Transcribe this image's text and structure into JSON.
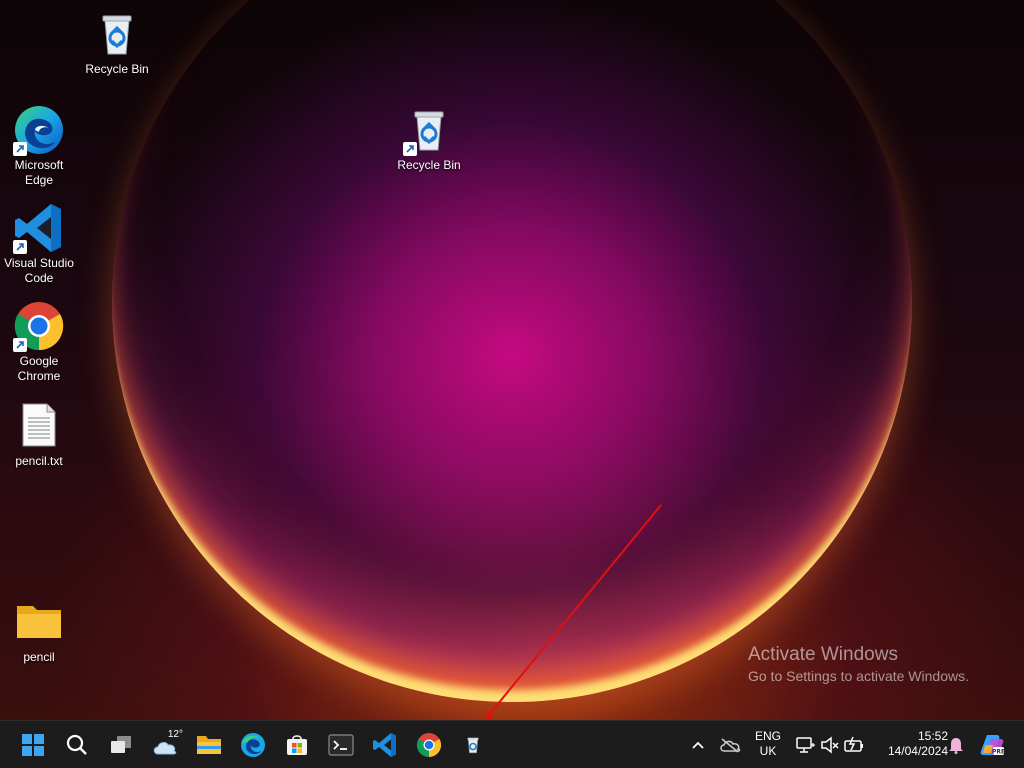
{
  "desktop_icons": [
    {
      "id": "recycle-bin-1",
      "label": "Recycle Bin",
      "icon": "recycle-bin-icon",
      "shortcut": false
    },
    {
      "id": "microsoft-edge",
      "label": "Microsoft Edge",
      "icon": "edge-icon",
      "shortcut": true
    },
    {
      "id": "vscode",
      "label": "Visual Studio Code",
      "icon": "vscode-icon",
      "shortcut": true
    },
    {
      "id": "google-chrome",
      "label": "Google Chrome",
      "icon": "chrome-icon",
      "shortcut": true
    },
    {
      "id": "pencil-txt",
      "label": "pencil.txt",
      "icon": "text-file-icon",
      "shortcut": false
    },
    {
      "id": "pencil-folder",
      "label": "pencil",
      "icon": "folder-icon",
      "shortcut": false
    },
    {
      "id": "recycle-bin-2",
      "label": "Recycle Bin",
      "icon": "recycle-bin-icon",
      "shortcut": true
    }
  ],
  "desktop": {
    "icon_label_0": "Recycle Bin",
    "icon_label_1a": "Microsoft",
    "icon_label_1b": "Edge",
    "icon_label_2a": "Visual Studio",
    "icon_label_2b": "Code",
    "icon_label_3a": "Google",
    "icon_label_3b": "Chrome",
    "icon_label_4": "pencil.txt",
    "icon_label_5": "pencil",
    "icon_label_6": "Recycle Bin"
  },
  "watermark": {
    "title": "Activate Windows",
    "subtitle": "Go to Settings to activate Windows."
  },
  "taskbar": {
    "weather_temp": "12°",
    "pinned": [
      "start-icon",
      "search-icon",
      "task-view-icon",
      "weather-icon",
      "file-explorer-icon",
      "edge-icon",
      "microsoft-store-icon",
      "terminal-icon",
      "vscode-icon",
      "chrome-icon",
      "recycle-bin-icon"
    ]
  },
  "tray": {
    "lang_top": "ENG",
    "lang_bottom": "UK",
    "time": "15:52",
    "date": "14/04/2024"
  },
  "colors": {
    "taskbar_bg": "#1c1c1c",
    "accent_blue": "#0078d4",
    "folder_yellow": "#f8c33a",
    "arrow_red": "#e01010"
  }
}
